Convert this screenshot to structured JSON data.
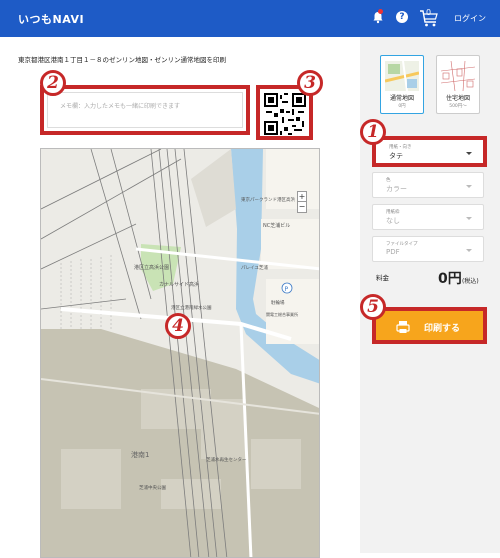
{
  "header": {
    "logo": "いつもNAVI",
    "cart_count": "0",
    "login_label": "ログイン",
    "icons": [
      "bell-icon",
      "help-icon",
      "cart-icon"
    ],
    "brand_color": "#1e5bc6"
  },
  "main": {
    "address": "東京都港区港南１丁目１－８のゼンリン地図・ゼンリン通常地図を印刷",
    "memo_placeholder": "メモ欄：入力したメモも一緒に印刷できます",
    "map_labels": {
      "park": "港区立高浜公園",
      "side_park": "カナルサイド高浜",
      "crossing": "港区立港南緑水公園",
      "building": "東京パークランド港区高浜",
      "canal": "NC芝浦ビル",
      "center": "芝浦水再生センター",
      "minami": "港南1",
      "small_park": "芝浦中央公園",
      "shop": "パレイユ芝浦",
      "parking": "駐輪場",
      "inst": "関電工総合事業所"
    }
  },
  "side": {
    "map_types": [
      {
        "label": "通常地図",
        "price": "0円",
        "active": true
      },
      {
        "label": "住宅地図",
        "price": "500円〜",
        "active": false
      }
    ],
    "orientation": {
      "caption": "用紙・向き",
      "value": "タテ"
    },
    "color": {
      "caption": "色",
      "value": "カラー"
    },
    "paper": {
      "caption": "用紙枠",
      "value": "なし"
    },
    "file_type": {
      "caption": "ファイルタイプ",
      "value": "PDF"
    },
    "fee_label": "料金",
    "fee_value": "0円",
    "fee_tax": "(税込)",
    "print_label": "印刷する",
    "print_color": "#f7a51c"
  },
  "annotations": [
    "1",
    "2",
    "3",
    "4",
    "5"
  ],
  "annotation_color": "#c62828"
}
